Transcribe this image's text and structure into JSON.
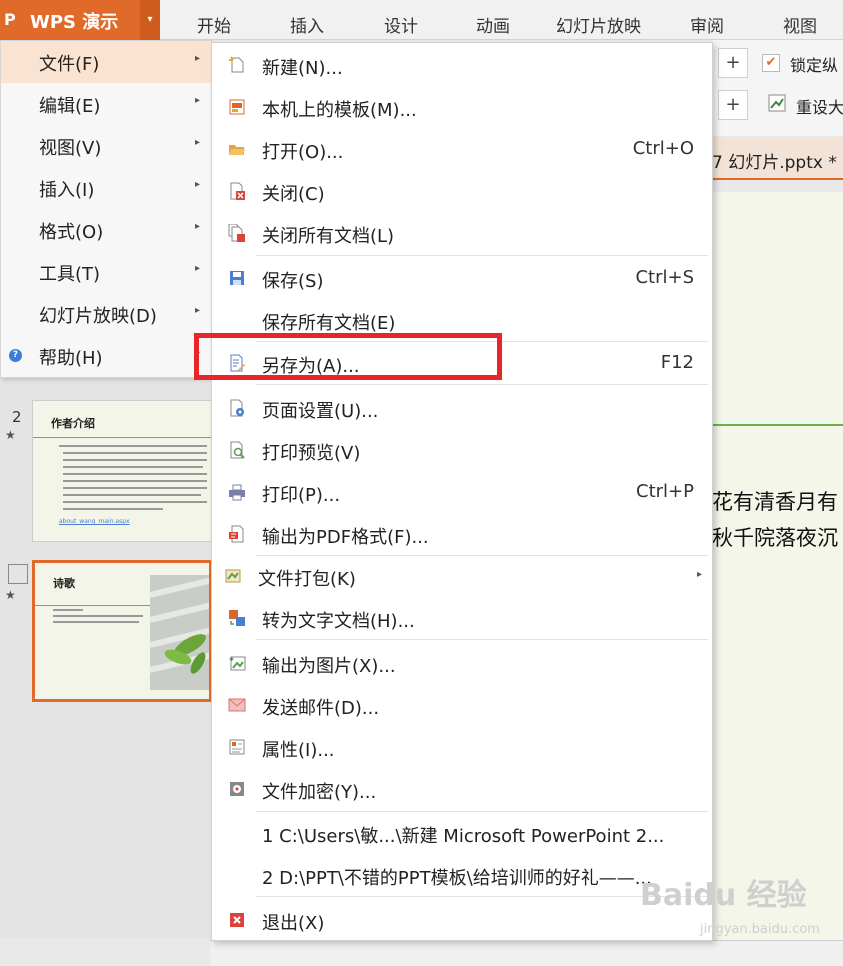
{
  "app": {
    "logo_text": "P",
    "title": "WPS 演示",
    "dropdown_glyph": "▾"
  },
  "ribbon_tabs": [
    "开始",
    "插入",
    "设计",
    "动画",
    "幻灯片放映",
    "审阅",
    "视图"
  ],
  "toolbar": {
    "plus": "+",
    "lock_label": "锁定纵",
    "reset_label": "重设大",
    "check_glyph": "✔"
  },
  "doc_tab": "7 幻灯片.pptx *",
  "slide_text": [
    "花有清香月有",
    "秋千院落夜沉"
  ],
  "main_menu": [
    {
      "label": "文件(F)",
      "arrow": "▸"
    },
    {
      "label": "编辑(E)",
      "arrow": "▸"
    },
    {
      "label": "视图(V)",
      "arrow": "▸"
    },
    {
      "label": "插入(I)",
      "arrow": "▸"
    },
    {
      "label": "格式(O)",
      "arrow": "▸"
    },
    {
      "label": "工具(T)",
      "arrow": "▸"
    },
    {
      "label": "幻灯片放映(D)",
      "arrow": "▸"
    },
    {
      "label": "帮助(H)",
      "arrow": "▸"
    }
  ],
  "file_menu": [
    {
      "label": "新建(N)...",
      "shortcut": "",
      "icon": "new-file-icon",
      "color": "#e8a33d"
    },
    {
      "label": "本机上的模板(M)...",
      "shortcut": "",
      "icon": "template-icon",
      "color": "#d9672c"
    },
    {
      "label": "打开(O)...",
      "shortcut": "Ctrl+O",
      "icon": "open-folder-icon",
      "color": "#e8a33d"
    },
    {
      "label": "关闭(C)",
      "shortcut": "",
      "icon": "close-doc-icon",
      "color": "#d9433a"
    },
    {
      "label": "关闭所有文档(L)",
      "shortcut": "",
      "icon": "close-all-icon",
      "color": "#d9433a"
    },
    {
      "label": "保存(S)",
      "shortcut": "Ctrl+S",
      "icon": "save-icon",
      "color": "#4a7fcf"
    },
    {
      "label": "保存所有文档(E)",
      "shortcut": "",
      "icon": "",
      "color": ""
    },
    {
      "label": "另存为(A)...",
      "shortcut": "F12",
      "icon": "save-as-icon",
      "color": "#5a7ec8"
    },
    {
      "label": "页面设置(U)...",
      "shortcut": "",
      "icon": "page-setup-icon",
      "color": "#4a7fcf"
    },
    {
      "label": "打印预览(V)",
      "shortcut": "",
      "icon": "print-preview-icon",
      "color": "#5aa050"
    },
    {
      "label": "打印(P)...",
      "shortcut": "Ctrl+P",
      "icon": "printer-icon",
      "color": "#7b7fa8"
    },
    {
      "label": "输出为PDF格式(F)...",
      "shortcut": "",
      "icon": "pdf-icon",
      "color": "#d9433a"
    },
    {
      "label": "文件打包(K)",
      "shortcut": "",
      "icon": "package-icon",
      "color": "#5aa050",
      "arrow": "▸"
    },
    {
      "label": "转为文字文档(H)...",
      "shortcut": "",
      "icon": "convert-doc-icon",
      "color": "#d9672c"
    },
    {
      "label": "输出为图片(X)...",
      "shortcut": "",
      "icon": "export-image-icon",
      "color": "#5aa050"
    },
    {
      "label": "发送邮件(D)...",
      "shortcut": "",
      "icon": "mail-icon",
      "color": "#e0706a"
    },
    {
      "label": "属性(I)...",
      "shortcut": "",
      "icon": "properties-icon",
      "color": "#d9672c"
    },
    {
      "label": "文件加密(Y)...",
      "shortcut": "",
      "icon": "encrypt-icon",
      "color": "#666666"
    },
    {
      "label": "1 C:\\Users\\敏...\\新建 Microsoft PowerPoint 2...",
      "shortcut": "",
      "icon": "",
      "color": ""
    },
    {
      "label": "2 D:\\PPT\\不错的PPT模板\\给培训师的好礼——...",
      "shortcut": "",
      "icon": "",
      "color": ""
    },
    {
      "label": "退出(X)",
      "shortcut": "",
      "icon": "exit-icon",
      "color": "#d9433a"
    }
  ],
  "thumbnails": [
    {
      "number": "2",
      "star": "★",
      "title": "作者介绍",
      "link": "about_wang_main.aspx"
    },
    {
      "number": "",
      "star": "★",
      "title": "诗歌"
    }
  ],
  "watermark": {
    "brand": "Baidu 经验",
    "url": "jingyan.baidu.com"
  },
  "colors": {
    "accent": "#e06a2a",
    "highlight": "#e8262a",
    "slide_line": "#6db04a"
  }
}
